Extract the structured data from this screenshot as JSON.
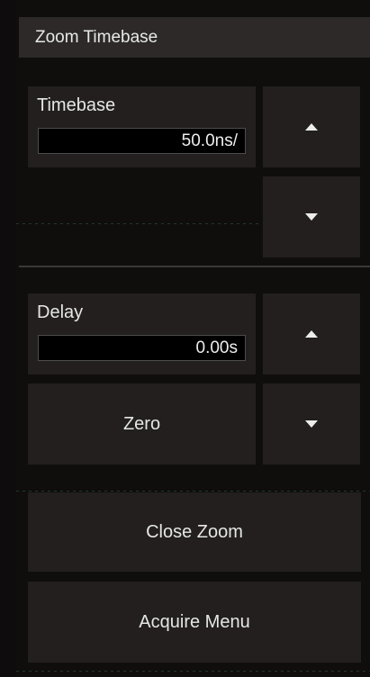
{
  "header": {
    "title": "Zoom Timebase"
  },
  "timebase": {
    "label": "Timebase",
    "value": "50.0ns/"
  },
  "delay": {
    "label": "Delay",
    "value": "0.00s"
  },
  "buttons": {
    "zero": "Zero",
    "close_zoom": "Close Zoom",
    "acquire_menu": "Acquire Menu"
  },
  "icons": {
    "up": "triangle-up-icon",
    "down": "triangle-down-icon"
  },
  "colors": {
    "background": "#0e0c0c",
    "header": "#2d2929",
    "tile": "#231f1f",
    "text": "#e6e6e6",
    "field_bg": "#000000"
  }
}
